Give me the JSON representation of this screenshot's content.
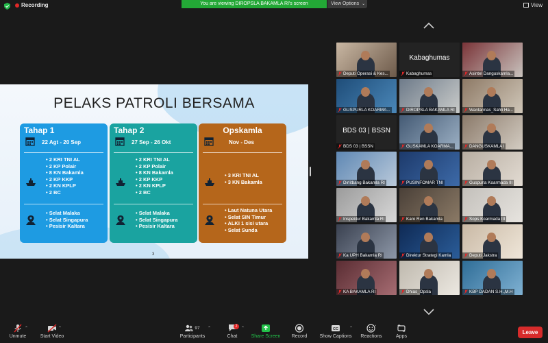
{
  "topbar": {
    "recording_label": "Recording",
    "viewing_banner": "You are viewing DIROPSLA BAKAMLA RI's screen",
    "view_options_label": "View Options",
    "view_label": "View"
  },
  "slide": {
    "title": "PELAKS PATROLI BERSAMA",
    "page_number": "3",
    "cards": [
      {
        "title": "Tahap 1",
        "date": "22 Agt - 20 Sep",
        "assets": [
          "2 KRI TNI AL",
          "2 KP Polair",
          "8 KN Bakamla",
          "2 KP KKP",
          "2 KN KPLP",
          "2 BC"
        ],
        "areas": [
          "Selat Malaka",
          "Selat Singapura",
          "Pesisir Kaltara"
        ],
        "color": "#1e9be2"
      },
      {
        "title": "Tahap 2",
        "date": "27 Sep - 26 Okt",
        "assets": [
          "2 KRI TNI AL",
          "2 KP Polair",
          "8 KN Bakamla",
          "2 KP KKP",
          "2 KN KPLP",
          "2 BC"
        ],
        "areas": [
          "Selat Malaka",
          "Selat Singapura",
          "Pesisir Kaltara"
        ],
        "color": "#1aa3a0"
      },
      {
        "title": "Opskamla",
        "date": "Nov - Des",
        "assets": [
          "3 KRI TNI AL",
          "3 KN Bakamla"
        ],
        "areas": [
          "Laut Natuna Utara",
          "Selat SIN Timur",
          "ALKI 1 sisi utara",
          "Selat Sunda"
        ],
        "color": "#b5661b"
      }
    ]
  },
  "gallery": {
    "tiles": [
      {
        "name": "Deputi Operasi & Kes...",
        "type": "video"
      },
      {
        "name": "Kabaghumas",
        "type": "text"
      },
      {
        "name": "Asintel Danguskamla...",
        "type": "video"
      },
      {
        "name": "GUSPURLA KOARMA...",
        "type": "video"
      },
      {
        "name": "DIROPSLA BAKAMLA RI",
        "type": "video"
      },
      {
        "name": "Wantannas_Sahli Ha...",
        "type": "video"
      },
      {
        "name": "BDS 03 | BSSN",
        "type": "text"
      },
      {
        "name": "GUSKAMLA KOARMA...",
        "type": "video"
      },
      {
        "name": "DANGUSKAMLA I",
        "type": "video"
      },
      {
        "name": "Dirlitbang Bakamla RI",
        "type": "video"
      },
      {
        "name": "PUSINFOMAR TNI",
        "type": "video"
      },
      {
        "name": "Guspurla Koarmada III",
        "type": "video"
      },
      {
        "name": "Inspektur Bakamla RI",
        "type": "video"
      },
      {
        "name": "Karo Ren Bakamla",
        "type": "video"
      },
      {
        "name": "Sops Koarmada III",
        "type": "video"
      },
      {
        "name": "Ka UPH Bakamla RI",
        "type": "video"
      },
      {
        "name": "Direktur Strategi Kamla",
        "type": "video"
      },
      {
        "name": "Deputi Jakstra",
        "type": "video"
      },
      {
        "name": "KA BAKAMLA RI",
        "type": "video"
      },
      {
        "name": "Dhias_Opsla",
        "type": "video"
      },
      {
        "name": "KBP DADAN S.H.,M.H",
        "type": "video"
      }
    ]
  },
  "toolbar": {
    "unmute": "Unmute",
    "start_video": "Start Video",
    "participants": "Participants",
    "participants_count": "97",
    "chat": "Chat",
    "chat_badge": "2",
    "share_screen": "Share Screen",
    "record": "Record",
    "show_captions": "Show Captions",
    "reactions": "Reactions",
    "apps": "Apps",
    "leave": "Leave"
  }
}
